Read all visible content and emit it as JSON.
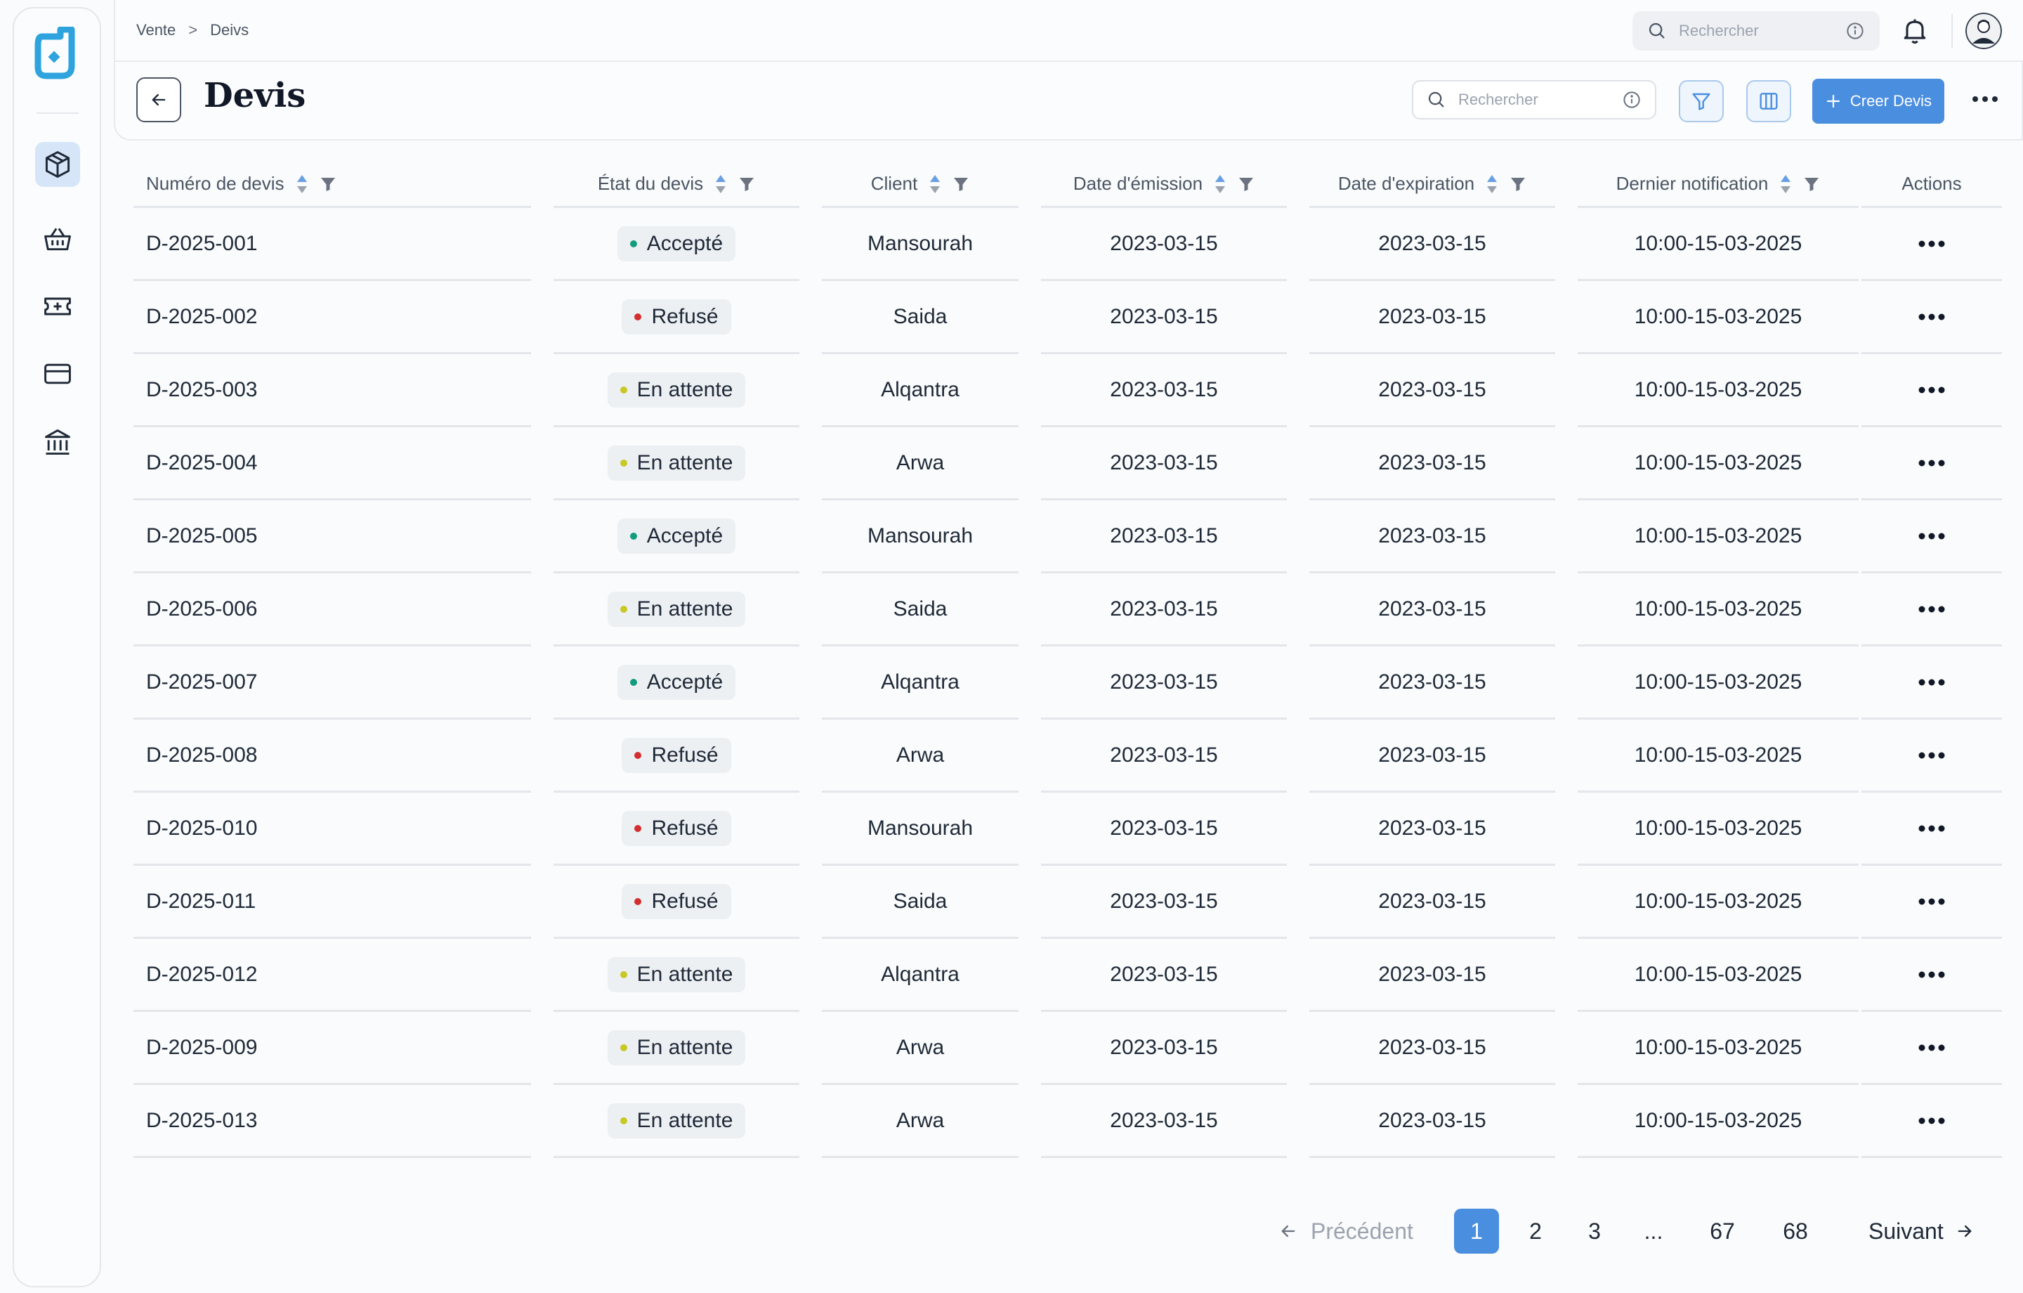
{
  "breadcrumb": {
    "items": [
      "Vente",
      "Deivs"
    ],
    "separator": ">"
  },
  "topbar": {
    "search_placeholder": "Rechercher"
  },
  "header": {
    "title": "Devis",
    "search_placeholder": "Rechercher",
    "create_label": "Creer Devis"
  },
  "colors": {
    "accent": "#4a8ee0",
    "active_nav": "#d6e6f8",
    "status_accepted": "#129b7d",
    "status_refused": "#d32f2f",
    "status_pending": "#c8c826"
  },
  "nav_icons": [
    "box-icon",
    "basket-icon",
    "ticket-icon",
    "card-icon",
    "bank-icon"
  ],
  "table": {
    "columns": [
      "Numéro de devis",
      "État du devis",
      "Client",
      "Date d'émission",
      "Date d'expiration",
      "Dernier notification",
      "Actions"
    ],
    "rows": [
      {
        "num": "D-2025-001",
        "status": "Accepté",
        "status_type": "accepted",
        "client": "Mansourah",
        "emission": "2023-03-15",
        "expiration": "2023-03-15",
        "notif": "10:00-15-03-2025"
      },
      {
        "num": "D-2025-002",
        "status": "Refusé",
        "status_type": "refused",
        "client": "Saida",
        "emission": "2023-03-15",
        "expiration": "2023-03-15",
        "notif": "10:00-15-03-2025"
      },
      {
        "num": "D-2025-003",
        "status": "En attente",
        "status_type": "pending",
        "client": "Alqantra",
        "emission": "2023-03-15",
        "expiration": "2023-03-15",
        "notif": "10:00-15-03-2025"
      },
      {
        "num": "D-2025-004",
        "status": "En attente",
        "status_type": "pending",
        "client": "Arwa",
        "emission": "2023-03-15",
        "expiration": "2023-03-15",
        "notif": "10:00-15-03-2025"
      },
      {
        "num": "D-2025-005",
        "status": "Accepté",
        "status_type": "accepted",
        "client": "Mansourah",
        "emission": "2023-03-15",
        "expiration": "2023-03-15",
        "notif": "10:00-15-03-2025"
      },
      {
        "num": "D-2025-006",
        "status": "En attente",
        "status_type": "pending",
        "client": "Saida",
        "emission": "2023-03-15",
        "expiration": "2023-03-15",
        "notif": "10:00-15-03-2025"
      },
      {
        "num": "D-2025-007",
        "status": "Accepté",
        "status_type": "accepted",
        "client": "Alqantra",
        "emission": "2023-03-15",
        "expiration": "2023-03-15",
        "notif": "10:00-15-03-2025"
      },
      {
        "num": "D-2025-008",
        "status": "Refusé",
        "status_type": "refused",
        "client": "Arwa",
        "emission": "2023-03-15",
        "expiration": "2023-03-15",
        "notif": "10:00-15-03-2025"
      },
      {
        "num": "D-2025-010",
        "status": "Refusé",
        "status_type": "refused",
        "client": "Mansourah",
        "emission": "2023-03-15",
        "expiration": "2023-03-15",
        "notif": "10:00-15-03-2025"
      },
      {
        "num": "D-2025-011",
        "status": "Refusé",
        "status_type": "refused",
        "client": "Saida",
        "emission": "2023-03-15",
        "expiration": "2023-03-15",
        "notif": "10:00-15-03-2025"
      },
      {
        "num": "D-2025-012",
        "status": "En attente",
        "status_type": "pending",
        "client": "Alqantra",
        "emission": "2023-03-15",
        "expiration": "2023-03-15",
        "notif": "10:00-15-03-2025"
      },
      {
        "num": "D-2025-009",
        "status": "En attente",
        "status_type": "pending",
        "client": "Arwa",
        "emission": "2023-03-15",
        "expiration": "2023-03-15",
        "notif": "10:00-15-03-2025"
      },
      {
        "num": "D-2025-013",
        "status": "En attente",
        "status_type": "pending",
        "client": "Arwa",
        "emission": "2023-03-15",
        "expiration": "2023-03-15",
        "notif": "10:00-15-03-2025"
      }
    ]
  },
  "pagination": {
    "prev_label": "Précédent",
    "next_label": "Suivant",
    "pages": [
      "1",
      "2",
      "3",
      "...",
      "67",
      "68"
    ],
    "current": "1"
  }
}
